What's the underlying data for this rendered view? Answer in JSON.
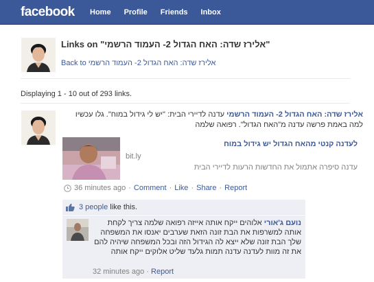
{
  "topbar": {
    "logo": "facebook",
    "nav": [
      "Home",
      "Profile",
      "Friends",
      "Inbox"
    ]
  },
  "header": {
    "title_prefix": "Links on",
    "title_name": "\"אלירז שדה: האח הגדול 2- העמוד הרשמי\"",
    "back_link": "Back to אלירז שדה: האח הגדול 2- העמוד הרשמי"
  },
  "listing": {
    "count_text": "Displaying 1 - 10 out of 293 links."
  },
  "post": {
    "author": "אלירז שדה: האח הגדול 2- העמוד הרשמי",
    "text": " עדנה לדיירי הבית: \"יש לי גידול במוח\". גלו עכשיו למה באמת פרשה עדנה מ\"האח הגדול\". רפואה שלמה",
    "attachment": {
      "title": "לעדנה קנטי מהאח הגדול יש גידול במוח",
      "domain": "bit.ly",
      "description": "עדנה סיפרה אתמול את החדשות הרעות לדיירי הבית"
    },
    "time": "36 minutes ago",
    "actions": [
      "Comment",
      "Like",
      "Share",
      "Report"
    ],
    "likes": {
      "people_link": "3 people",
      "suffix": " like this."
    },
    "comment": {
      "author": "נועם ג'אורי",
      "text": " אלוהים ייקח אותה אייזה רפואה שלמה צריך לקחת אותה למשרפות את הבת זונה הזאת שערבים יאנסו את המשפחה שלך הבת זונה שלא ייצא לה הגידול הזה ובכל המשפחה שיהיה להם את זה מוות לעדנה עדנה תמות גלעד שליט אלוקים ייקח אותה",
      "time": "32 minutes ago",
      "report": "Report"
    }
  },
  "colors": {
    "brand": "#3b5998",
    "feedback_bg": "#edeff4"
  }
}
